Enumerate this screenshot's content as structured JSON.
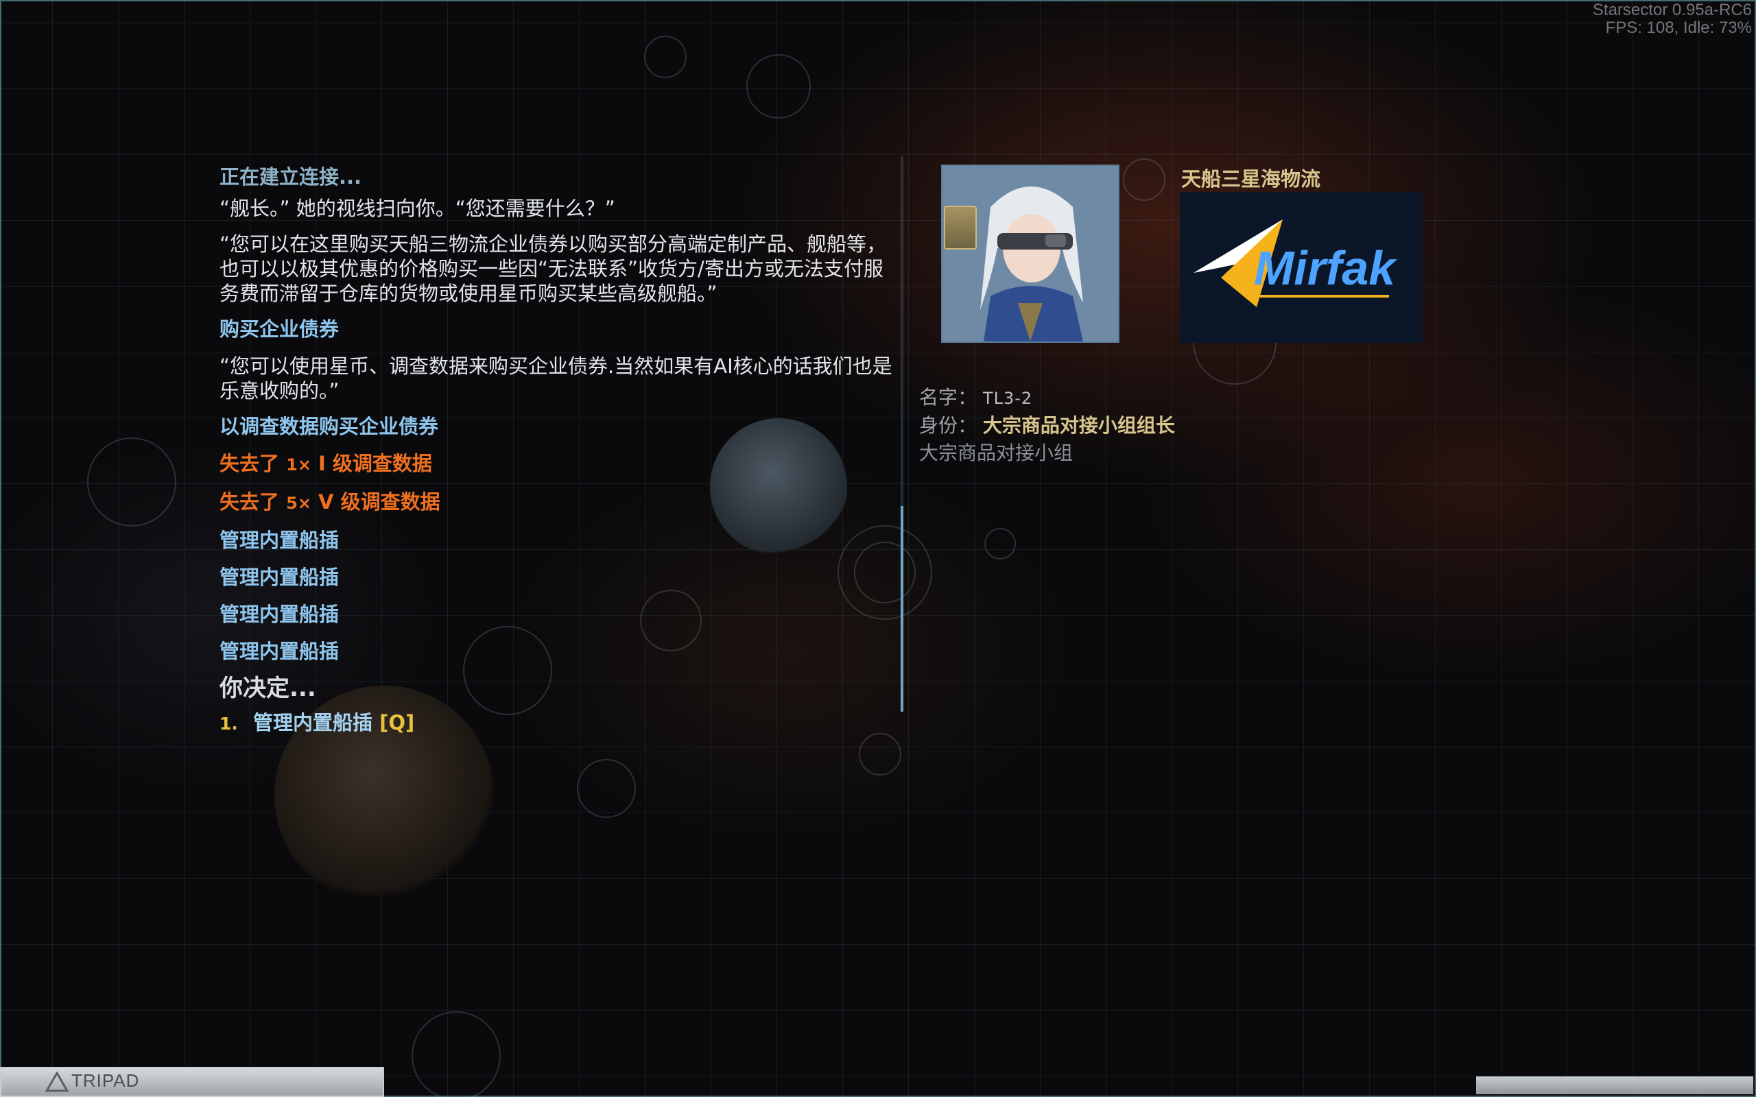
{
  "perf_overlay": {
    "line1": "Starsector 0.95a-RC6",
    "line2": "FPS: 108, Idle: 73%"
  },
  "dialog": {
    "status": "正在建立连接...",
    "greeting": "“舰长。” 她的视线扫向你。“您还需要什么？”",
    "offer": "“您可以在这里购买天船三物流企业债券以购买部分高端定制产品、舰船等，也可以以极其优惠的价格购买一些因“无法联系”收货方/寄出方或无法支付服务费而滞留于仓库的货物或使用星币购买某些高级舰船。”",
    "option_buy_bonds": "购买企业债券",
    "bonds_explanation": "“您可以使用星币、调查数据来购买企业债券.当然如果有AI核心的话我们也是乐意收购的。”",
    "option_buy_with_data": "以调查数据购买企业债券",
    "lost_items": [
      {
        "prefix": "失去了",
        "qty": "1×",
        "item": "I 级调查数据"
      },
      {
        "prefix": "失去了",
        "qty": "5×",
        "item": "V 级调查数据"
      }
    ],
    "manage_options": [
      "管理内置船插",
      "管理内置船插",
      "管理内置船插",
      "管理内置船插"
    ],
    "decide_prompt": "你决定...",
    "choices": [
      {
        "number": "1.",
        "label": "管理内置船插",
        "hotkey": "[Q]"
      }
    ]
  },
  "faction": {
    "name": "天船三星海物流",
    "logo_text": "Mirfak",
    "logo_colors": {
      "accent": "#f5b21a",
      "text": "#4da3ff",
      "bg": "#0b1729"
    }
  },
  "person": {
    "name_label": "名字：",
    "name": "TL3-2",
    "rank_label": "身份：",
    "rank": "大宗商品对接小组组长",
    "group": "大宗商品对接小组"
  },
  "bottom_bar": {
    "label": "TRIPAD"
  }
}
